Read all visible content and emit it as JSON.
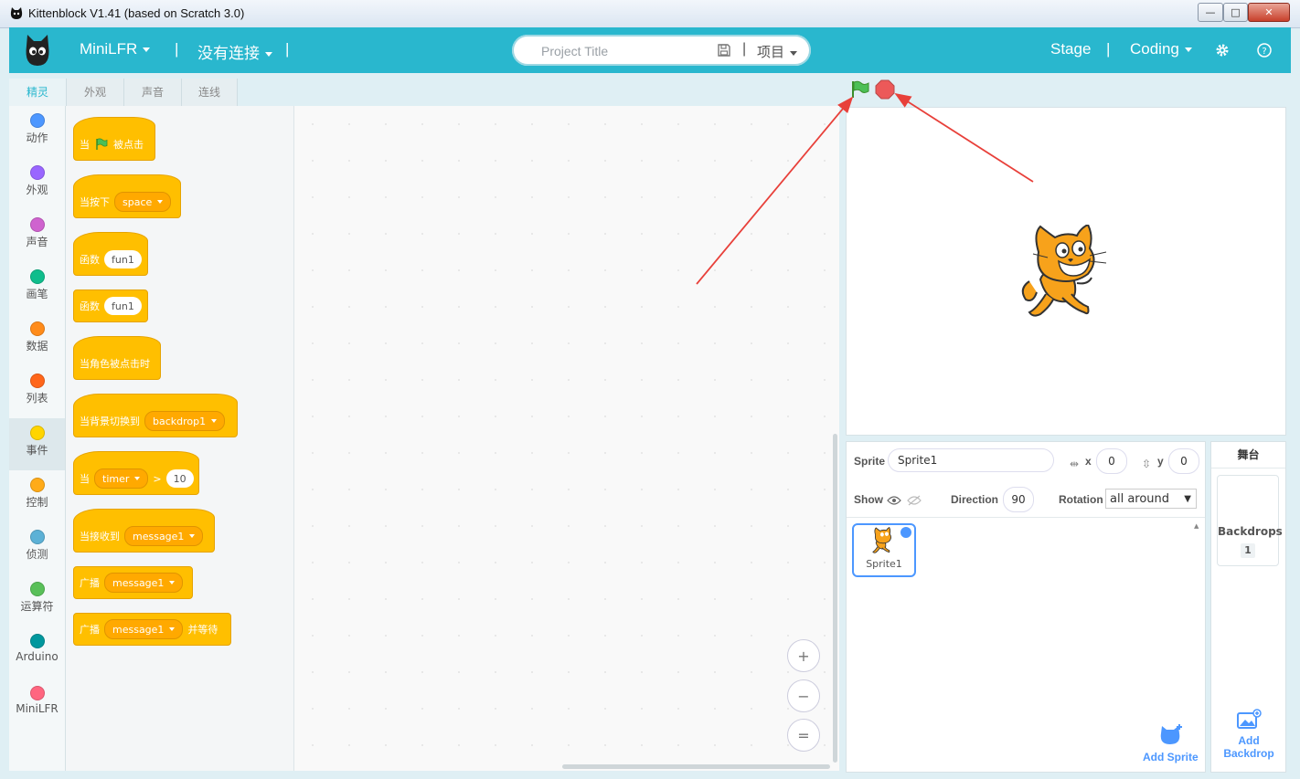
{
  "window": {
    "title": "Kittenblock V1.41 (based on Scratch 3.0)",
    "minimize": "—",
    "maximize": "□",
    "close": "✕"
  },
  "header": {
    "device": "MiniLFR",
    "connection": "没有连接",
    "separator": "|",
    "project_placeholder": "Project Title",
    "project_menu": "项目",
    "stage": "Stage",
    "mode": "Coding"
  },
  "left_tabs": [
    "精灵",
    "外观",
    "声音",
    "连线"
  ],
  "categories": [
    {
      "label": "动作",
      "color": "#4c97ff"
    },
    {
      "label": "外观",
      "color": "#9966ff"
    },
    {
      "label": "声音",
      "color": "#cf63cf"
    },
    {
      "label": "画笔",
      "color": "#0fbd8c"
    },
    {
      "label": "数据",
      "color": "#ff8c1a"
    },
    {
      "label": "列表",
      "color": "#ff661a"
    },
    {
      "label": "事件",
      "color": "#ffd500"
    },
    {
      "label": "控制",
      "color": "#ffab19"
    },
    {
      "label": "侦测",
      "color": "#5cb1d6"
    },
    {
      "label": "运算符",
      "color": "#59c059"
    },
    {
      "label": "Arduino",
      "color": "#00979d"
    },
    {
      "label": "MiniLFR",
      "color": "#ff6680"
    }
  ],
  "blocks": {
    "flag_clicked": {
      "pre": "当",
      "post": "被点击"
    },
    "key_pressed": {
      "pre": "当按下",
      "dropdown": "space"
    },
    "func1": {
      "label": "函数",
      "arg": "fun1"
    },
    "func2": {
      "label": "函数",
      "arg": "fun1"
    },
    "sprite_clicked": {
      "label": "当角色被点击时"
    },
    "backdrop_switch": {
      "label": "当背景切换到",
      "dropdown": "backdrop1"
    },
    "timer_gt": {
      "pre": "当",
      "dropdown": "timer",
      "op": ">",
      "value": "10"
    },
    "receive": {
      "label": "当接收到",
      "dropdown": "message1"
    },
    "broadcast": {
      "label": "广播",
      "dropdown": "message1"
    },
    "broadcast_wait": {
      "label": "广播",
      "dropdown": "message1",
      "post": "并等待"
    }
  },
  "zoom": {
    "in": "+",
    "out": "−",
    "reset": "="
  },
  "sprite_info": {
    "sprite_label": "Sprite",
    "sprite_name": "Sprite1",
    "x_label": "x",
    "x_value": "0",
    "y_label": "y",
    "y_value": "0",
    "show_label": "Show",
    "direction_label": "Direction",
    "direction_value": "90",
    "rotation_label": "Rotation",
    "rotation_value": "all around"
  },
  "sprites": [
    {
      "name": "Sprite1"
    }
  ],
  "stage_panel": {
    "title": "舞台",
    "backdrops_label": "Backdrops",
    "backdrops_count": "1",
    "add_backdrop": "Add Backdrop"
  },
  "add_sprite": "Add Sprite",
  "colors": {
    "header": "#29b7ce",
    "event_block": "#ffbf00",
    "accent": "#4c97ff"
  }
}
